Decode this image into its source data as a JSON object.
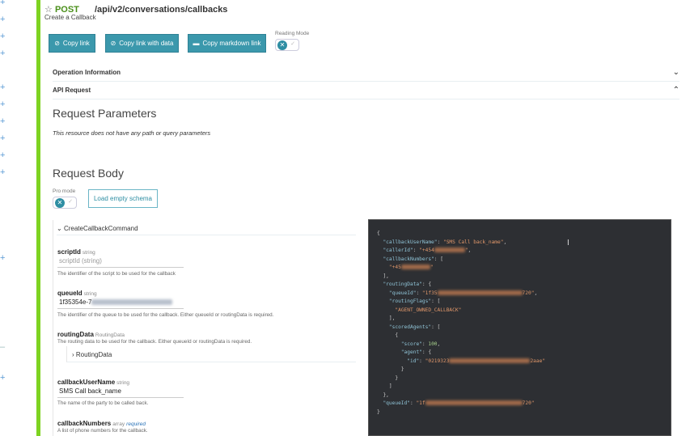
{
  "header": {
    "star_icon": "☆",
    "method": "POST",
    "path": "/api/v2/conversations/callbacks",
    "summary": "Create a Callback"
  },
  "buttons": {
    "copy_link": "Copy link",
    "copy_link_data": "Copy link with data",
    "copy_markdown": "Copy markdown link"
  },
  "reading_mode": {
    "label": "Reading Mode",
    "enabled": false
  },
  "sections": {
    "operation_info": "Operation Information",
    "api_request": "API Request"
  },
  "request_params": {
    "title": "Request Parameters",
    "note": "This resource does not have any path or query parameters"
  },
  "request_body": {
    "title": "Request Body",
    "pro_mode_label": "Pro mode",
    "pro_mode_enabled": false,
    "load_empty": "Load empty schema"
  },
  "schema": {
    "name": "CreateCallbackCommand",
    "fields": [
      {
        "name": "scriptId",
        "type": "string",
        "placeholder": "scriptId (string)",
        "description": "The identifier of the script to be used for the callback"
      },
      {
        "name": "queueId",
        "type": "string",
        "value": "1f35354e-7",
        "description": "The identifier of the queue to be used for the callback. Either queueId or routingData is required."
      },
      {
        "name": "routingData",
        "type": "RoutingData",
        "description": "The routing data to be used for the callback. Either queueId or routingData is required.",
        "child": "RoutingData"
      },
      {
        "name": "callbackUserName",
        "type": "string",
        "value": "SMS Call back_name",
        "description": "The name of the party to be called back."
      },
      {
        "name": "callbackNumbers",
        "type": "array",
        "required": "required",
        "description": "A list of phone numbers for the callback."
      }
    ]
  },
  "code": {
    "callbackUserName": "SMS Call back_name",
    "callerId_prefix": "+454",
    "callbackNumber_prefix": "+45",
    "queueId_prefix": "1f35",
    "queueId_suffix": "720",
    "routingFlag": "AGENT_OWNED_CALLBACK",
    "score": "100",
    "agentId_prefix": "0219323",
    "agentId_suffix": "2aae",
    "queueId2_prefix": "1f",
    "queueId2_suffix": "720"
  },
  "colors": {
    "accent": "#3b98ac",
    "method": "#4a8f1a",
    "sidebar_bar": "#7ed321",
    "code_bg": "#2d2f33"
  }
}
